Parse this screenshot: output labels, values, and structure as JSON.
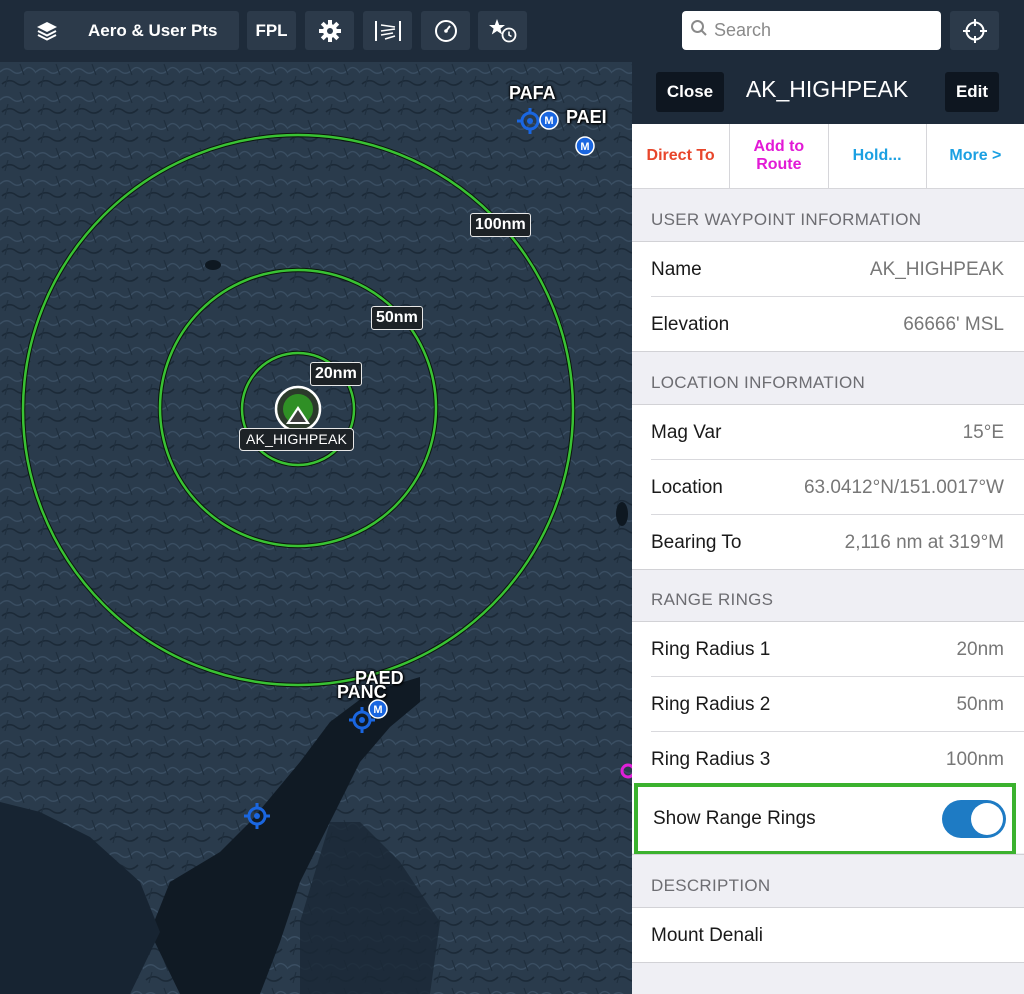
{
  "toolbar": {
    "layers_label": "Aero & User Pts",
    "fpl_label": "FPL",
    "search_placeholder": "Search",
    "icons": [
      "layers-icon",
      "gear-icon",
      "procedure-icon",
      "gauge-icon",
      "recent-favorites-icon",
      "locate-icon"
    ]
  },
  "map": {
    "ring_labels": {
      "r20": "20nm",
      "r50": "50nm",
      "r100": "100nm"
    },
    "waypoint_label": "AK_HIGHPEAK",
    "airports": {
      "pafa": "PAFA",
      "paei": "PAEI",
      "paed": "PAED",
      "panc": "PANC"
    },
    "military_badge": "M",
    "ring_color": "#39c234"
  },
  "panel": {
    "close_label": "Close",
    "title": "AK_HIGHPEAK",
    "edit_label": "Edit",
    "actions": [
      {
        "label": "Direct To",
        "color": "#e8462b"
      },
      {
        "label": "Add to Route",
        "color": "#e21ad6"
      },
      {
        "label": "Hold...",
        "color": "#1ba0e2"
      },
      {
        "label": "More >",
        "color": "#1ba0e2"
      }
    ],
    "sections": {
      "user_waypoint": "USER WAYPOINT INFORMATION",
      "location": "LOCATION INFORMATION",
      "range_rings": "RANGE RINGS",
      "description": "DESCRIPTION"
    },
    "rows": {
      "name": {
        "label": "Name",
        "value": "AK_HIGHPEAK"
      },
      "elevation": {
        "label": "Elevation",
        "value": "66666' MSL"
      },
      "mag_var": {
        "label": "Mag Var",
        "value": "15°E"
      },
      "location": {
        "label": "Location",
        "value": "63.0412°N/151.0017°W"
      },
      "bearing_to": {
        "label": "Bearing To",
        "value": "2,116 nm at 319°M"
      },
      "ring1": {
        "label": "Ring Radius 1",
        "value": "20nm"
      },
      "ring2": {
        "label": "Ring Radius 2",
        "value": "50nm"
      },
      "ring3": {
        "label": "Ring Radius 3",
        "value": "100nm"
      }
    },
    "show_range_rings": {
      "label": "Show Range Rings",
      "on": true
    },
    "description_text": "Mount Denali"
  }
}
